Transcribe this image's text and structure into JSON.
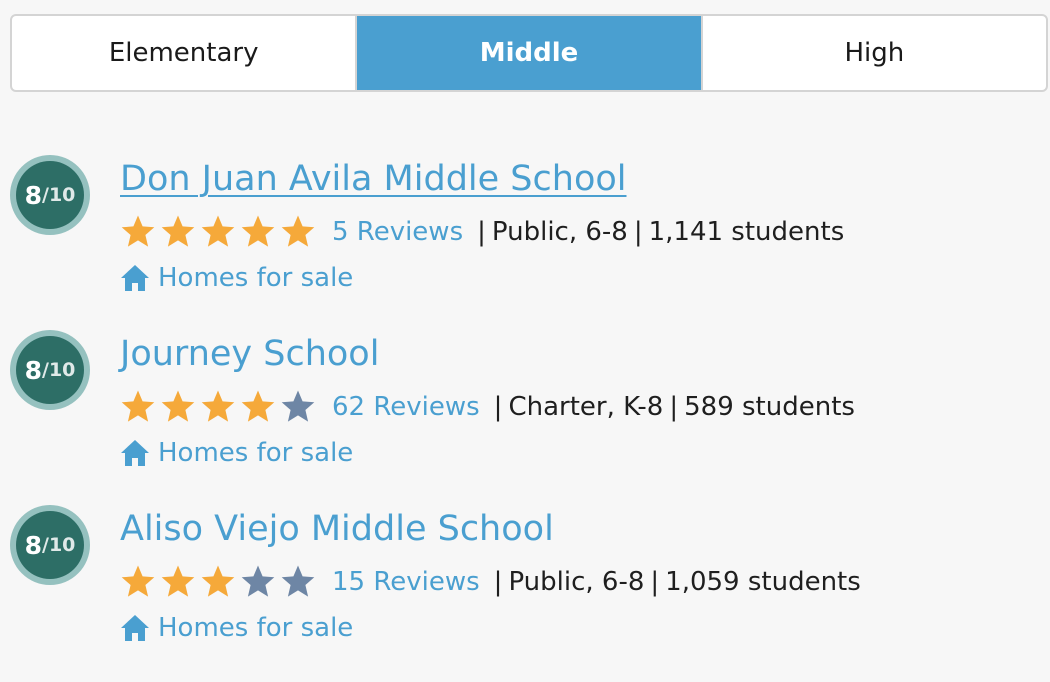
{
  "tabs": [
    {
      "label": "Elementary",
      "active": false
    },
    {
      "label": "Middle",
      "active": true
    },
    {
      "label": "High",
      "active": false
    }
  ],
  "colors": {
    "accent": "#4a9fd0",
    "star_filled": "#f5a93a",
    "star_empty": "#6e86a5",
    "badge": "#2d6e66"
  },
  "schools": [
    {
      "rating_score": "8",
      "rating_total": "/10",
      "name": "Don Juan Avila Middle School",
      "stars_filled": 5,
      "stars_total": 5,
      "reviews": "5 Reviews",
      "type": "Public, 6-8",
      "students": "1,141 students",
      "homes_label": "Homes for sale",
      "home_icon": "home-icon"
    },
    {
      "rating_score": "8",
      "rating_total": "/10",
      "name": "Journey School",
      "stars_filled": 4,
      "stars_total": 5,
      "reviews": "62 Reviews",
      "type": "Charter, K-8",
      "students": "589 students",
      "homes_label": "Homes for sale",
      "home_icon": "home-icon"
    },
    {
      "rating_score": "8",
      "rating_total": "/10",
      "name": "Aliso Viejo Middle School",
      "stars_filled": 3,
      "stars_total": 5,
      "reviews": "15 Reviews",
      "type": "Public, 6-8",
      "students": "1,059 students",
      "homes_label": "Homes for sale",
      "home_icon": "home-icon"
    }
  ]
}
